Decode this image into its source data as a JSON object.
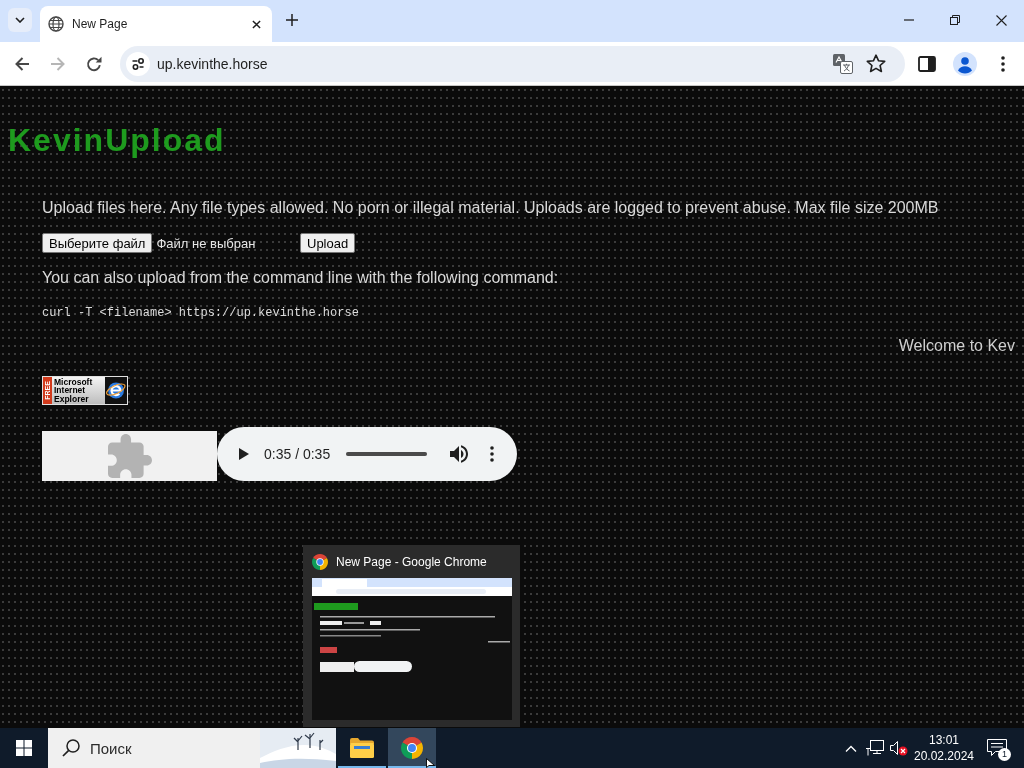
{
  "browser": {
    "tabs": [
      {
        "title": "New Page",
        "selected": true
      }
    ],
    "nav_buttons": [
      {
        "kind": "back",
        "disabled": false
      },
      {
        "kind": "forward",
        "disabled": true
      },
      {
        "kind": "reload",
        "disabled": false
      }
    ],
    "address": "up.kevinthe.horse"
  },
  "page": {
    "title": "KevinUpload",
    "intro": "Upload files here. Any file types allowed. No porn or illegal material. Uploads are logged to prevent abuse. Max file size 200MB",
    "file_button": "Выберите файл",
    "file_status": "Файл не выбран",
    "upload_button": "Upload",
    "cli_text": "You can also upload from the command line with the following command:",
    "command": "curl -T <filename> https://up.kevinthe.horse",
    "marquee": "Welcome to Kev",
    "badge": {
      "side_text": "FREE",
      "lines": [
        "Microsoft",
        "Internet",
        "Explorer"
      ]
    },
    "audio": {
      "time": "0:35 / 0:35",
      "level": 1
    }
  },
  "window_preview": {
    "title": "New Page - Google Chrome"
  },
  "taskbar": {
    "search": {
      "label": "Поиск"
    },
    "apps": [
      {
        "kind": "explorer",
        "selected": false
      },
      {
        "kind": "chrome",
        "selected": true
      }
    ],
    "clock": {
      "time": "13:01",
      "date": "20.02.2024"
    },
    "notifications": "1"
  }
}
